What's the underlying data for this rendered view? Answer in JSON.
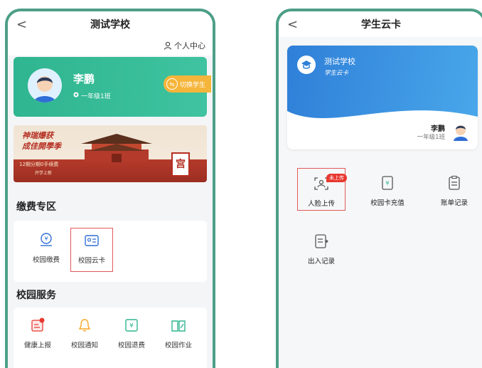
{
  "left": {
    "nav_title": "测试学校",
    "back_glyph": "<",
    "profile_link": "个人中心",
    "student": {
      "name": "李鹏",
      "class": "一年级1班",
      "switch_label": "切换学生"
    },
    "banner": {
      "line1": "神瑞爆获",
      "line2": "成佳開學季",
      "line3": "12期分期0手续费",
      "line4": "开学上新"
    },
    "payment_section": {
      "title": "缴费专区",
      "items": [
        {
          "label": "校园缴费",
          "icon": "payment-icon"
        },
        {
          "label": "校园云卡",
          "icon": "id-card-icon"
        }
      ]
    },
    "service_section": {
      "title": "校园服务",
      "items": [
        {
          "label": "健康上报",
          "icon": "health-report-icon"
        },
        {
          "label": "校园通知",
          "icon": "bell-icon"
        },
        {
          "label": "校园退费",
          "icon": "refund-icon"
        },
        {
          "label": "校园作业",
          "icon": "homework-book-icon"
        }
      ]
    }
  },
  "right": {
    "nav_title": "学生云卡",
    "back_glyph": "<",
    "card": {
      "school": "测试学校",
      "subtitle": "学生云卡",
      "name": "李鹏",
      "class": "一年级1班"
    },
    "actions": [
      {
        "label": "人脸上传",
        "icon": "face-scan-icon",
        "badge": "未上传"
      },
      {
        "label": "校园卡充值",
        "icon": "recharge-icon"
      },
      {
        "label": "账单记录",
        "icon": "bill-icon"
      },
      {
        "label": "出入记录",
        "icon": "access-record-icon"
      }
    ]
  },
  "colors": {
    "frame": "#4c9f87",
    "student_card": "#2fb58f",
    "switch_button": "#f5b53a",
    "cloud_card": "#2f7fd8",
    "highlight": "#e25a5a",
    "badge": "#e8382f"
  }
}
